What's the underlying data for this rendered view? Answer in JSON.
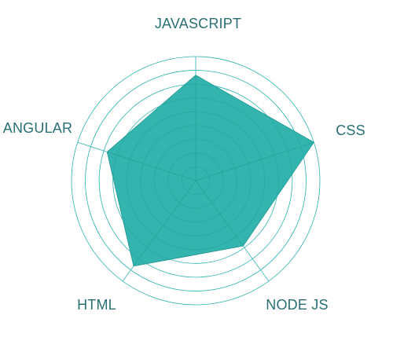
{
  "colors": {
    "fill": "#2fb2ad",
    "stroke": "#2a9f9a",
    "grid": "#2bb3ae",
    "label": "#2a6f73"
  },
  "chart_data": {
    "type": "radar",
    "categories": [
      "JAVASCRIPT",
      "CSS",
      "NODE JS",
      "HTML",
      "ANGULAR"
    ],
    "values": [
      85,
      100,
      65,
      85,
      75
    ],
    "rlim": [
      0,
      100
    ],
    "grid": true,
    "legend": "none"
  }
}
